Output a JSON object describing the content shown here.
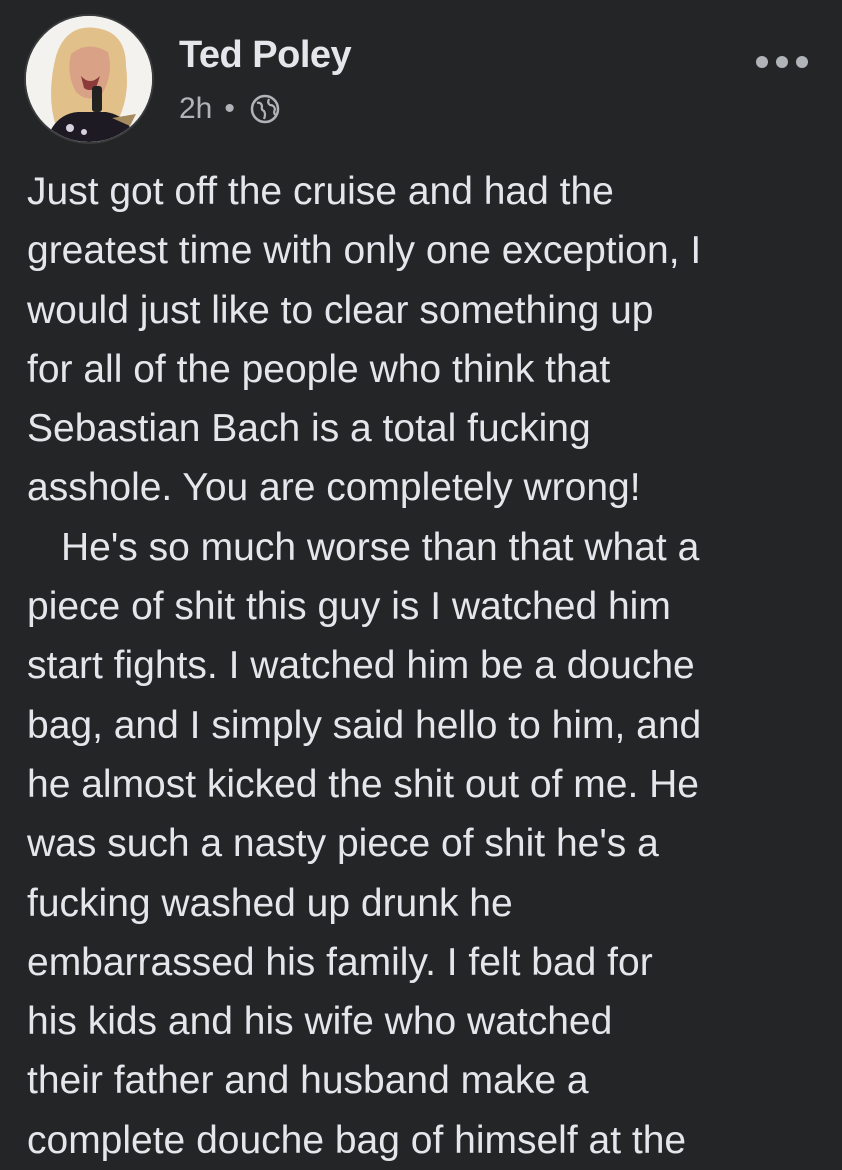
{
  "post": {
    "author": "Ted Poley",
    "time": "2h",
    "separator": "•",
    "privacy_icon": "globe-icon",
    "more_icon": "more-options-icon",
    "lines": [
      "Just got off the cruise and had the",
      "greatest time with only one exception, I",
      "would just like to clear something up",
      "for all of the people who think that",
      "Sebastian Bach is a total fucking",
      "asshole. You are completely wrong!",
      "He's so much worse than that what a",
      "piece of shit this guy is I watched him",
      "start fights. I watched him be a douche",
      "bag, and I simply said hello to him, and",
      "he almost kicked the shit out of me. He",
      "was such a nasty piece of shit he's a",
      "fucking washed up drunk he",
      "embarrassed his family. I felt bad for",
      "his kids and his wife who watched",
      "their father and husband make a",
      "complete douche bag of himself at the"
    ]
  },
  "colors": {
    "background": "#242526",
    "primary_text": "#e4e6eb",
    "secondary_text": "#b0b3b8"
  }
}
